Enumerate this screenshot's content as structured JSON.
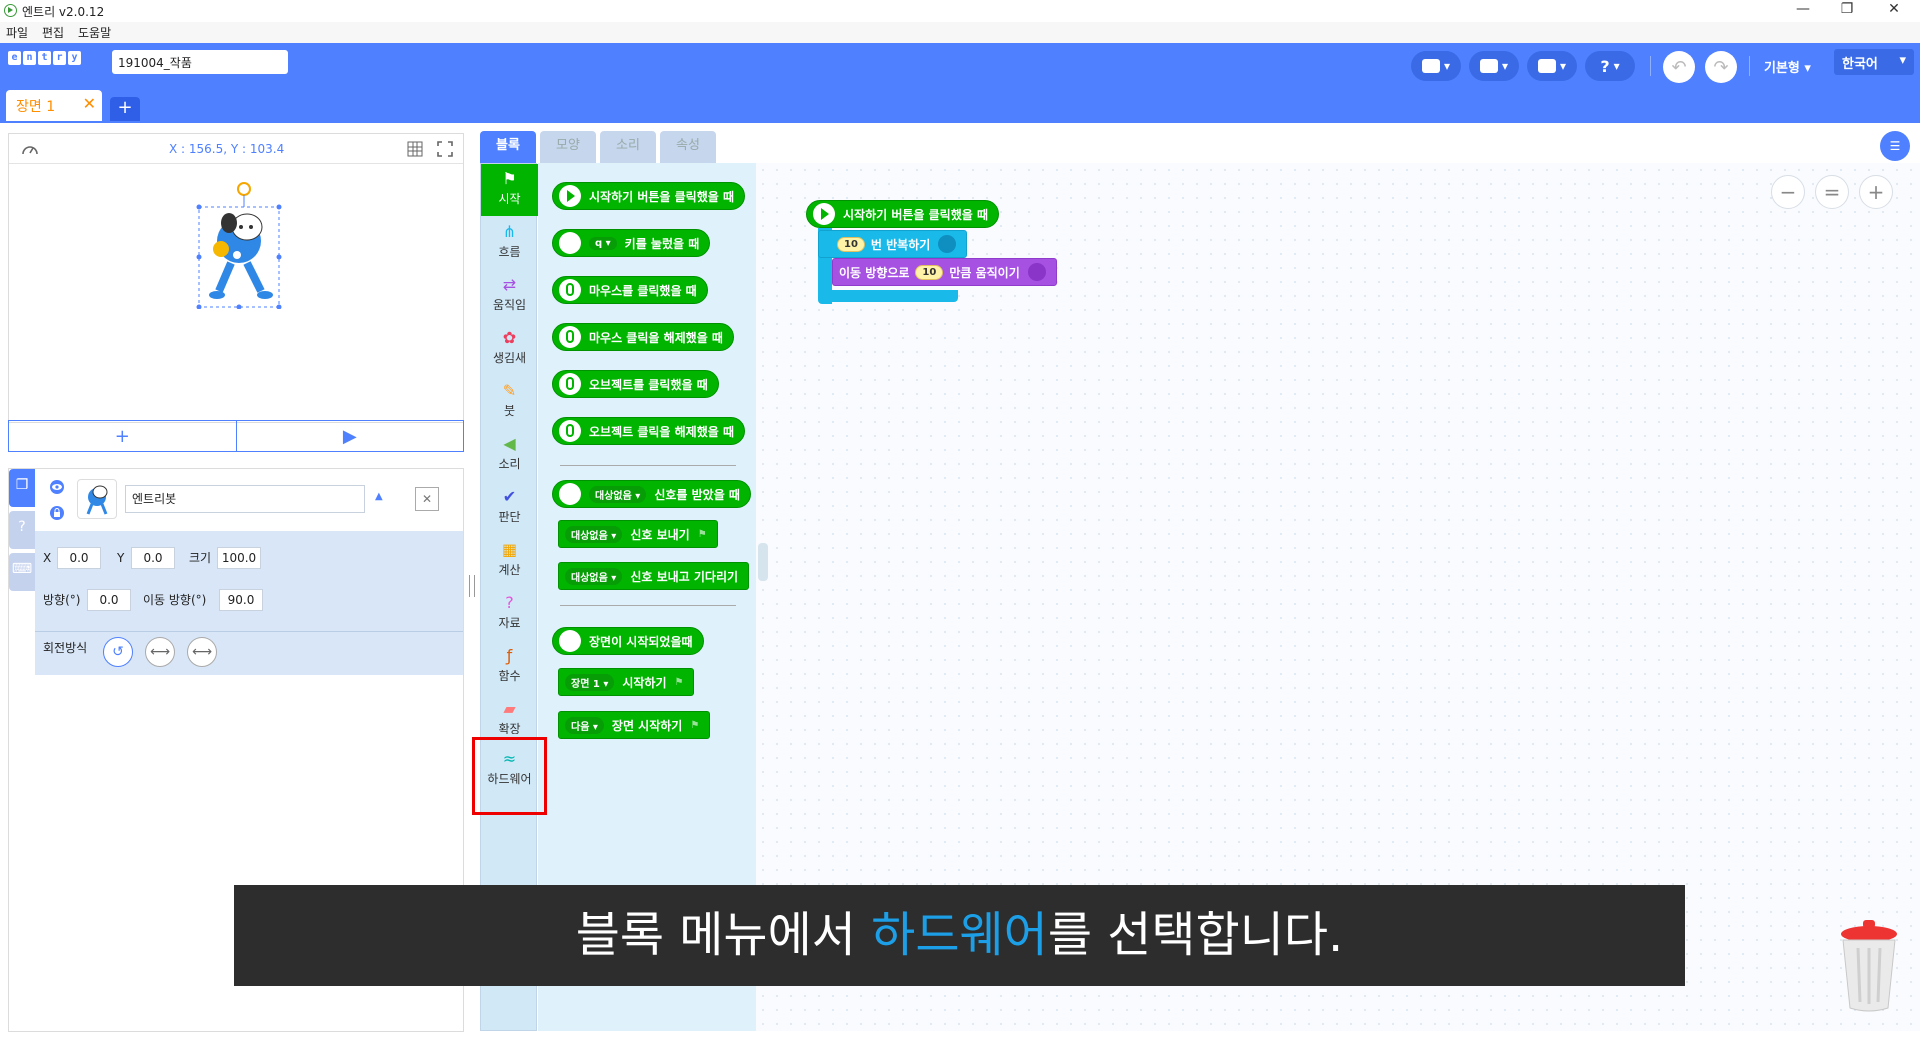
{
  "window": {
    "title": "엔트리 v2.0.12",
    "minimize": "—",
    "restore": "❐",
    "close": "✕"
  },
  "menu": [
    "파일",
    "편집",
    "도움말"
  ],
  "header": {
    "brand_letters": [
      "e",
      "n",
      "t",
      "r",
      "y"
    ],
    "project_name": "191004_작품",
    "buttons": [
      {
        "icon": "speech-bubble-icon",
        "caret": "▾"
      },
      {
        "icon": "document-icon",
        "caret": "▾"
      },
      {
        "icon": "save-icon",
        "caret": "▾"
      },
      {
        "icon": "help-icon",
        "label": "?",
        "caret": "▾"
      }
    ],
    "undo": "↶",
    "redo": "↷",
    "mode": "기본형 ▾",
    "language": "한국어",
    "language_caret": "▾"
  },
  "scene": {
    "tab_label": "장면 1",
    "close": "✕",
    "add": "+"
  },
  "stage": {
    "coords": "X : 156.5, Y : 103.4",
    "add_button": "+",
    "run_button": "▶"
  },
  "object": {
    "name": "엔트리봇",
    "x_label": "X",
    "x": "0.0",
    "y_label": "Y",
    "y": "0.0",
    "size_label": "크기",
    "size": "100.0",
    "direction_label": "방향(°)",
    "direction": "0.0",
    "move_dir_label": "이동 방향(°)",
    "move_dir": "90.0",
    "rotation_label": "회전방식",
    "close": "✕",
    "sort_caret": "▲"
  },
  "block_tabs": [
    "블록",
    "모양",
    "소리",
    "속성"
  ],
  "categories": [
    {
      "label": "시작",
      "icon": "⚑",
      "color": "#ffffff"
    },
    {
      "label": "흐름",
      "icon": "⋔",
      "color": "#19baea"
    },
    {
      "label": "움직임",
      "icon": "⇄",
      "color": "#a751e3"
    },
    {
      "label": "생김새",
      "icon": "✿",
      "color": "#ee3e5e"
    },
    {
      "label": "붓",
      "icon": "✎",
      "color": "#ff9e20"
    },
    {
      "label": "소리",
      "icon": "◀",
      "color": "#63b84a"
    },
    {
      "label": "판단",
      "icon": "✔",
      "color": "#4252e0"
    },
    {
      "label": "계산",
      "icon": "▦",
      "color": "#f3a600"
    },
    {
      "label": "자료",
      "icon": "?",
      "color": "#e457dc"
    },
    {
      "label": "함수",
      "icon": "ƒ",
      "color": "#de5c04"
    },
    {
      "label": "확장",
      "icon": "▰",
      "color": "#ff7a7a"
    },
    {
      "label": "하드웨어",
      "icon": "≈",
      "color": "#00b6b1"
    }
  ],
  "palette_blocks": [
    {
      "text": "시작하기 버튼을 클릭했을 때",
      "type": "play"
    },
    {
      "text": "키를 눌렀을 때",
      "dropdown": "q ▾",
      "type": "key"
    },
    {
      "text": "마우스를 클릭했을 때",
      "type": "mouse"
    },
    {
      "text": "마우스 클릭을 해제했을 때",
      "type": "mouse"
    },
    {
      "text": "오브젝트를 클릭했을 때",
      "type": "mouse"
    },
    {
      "text": "오브젝트 클릭을 해제했을 때",
      "type": "mouse"
    },
    {
      "text": "신호를 받았을 때",
      "dropdown": "대상없음 ▾",
      "type": "signal"
    },
    {
      "text": "신호 보내기",
      "dropdown": "대상없음 ▾",
      "type": "rect"
    },
    {
      "text": "신호 보내고 기다리기",
      "dropdown": "대상없음 ▾",
      "type": "rect"
    },
    {
      "text": "장면이 시작되었을때",
      "type": "scene"
    },
    {
      "text": "시작하기",
      "dropdown": "장면 1 ▾",
      "type": "rect"
    },
    {
      "text": "장면 시작하기",
      "dropdown": "다음 ▾",
      "type": "rect"
    }
  ],
  "script": {
    "hat": "시작하기 버튼을 클릭했을 때",
    "repeat_count": "10",
    "repeat_text": "번 반복하기",
    "move_prefix": "이동 방향으로",
    "move_amount": "10",
    "move_suffix": "만큼 움직이기"
  },
  "zoom": {
    "out": "−",
    "reset": "=",
    "in": "+"
  },
  "caption": {
    "before": "블록 메뉴에서 ",
    "highlight": "하드웨어",
    "after": "를 선택합니다."
  },
  "colors": {
    "header": "#4f80ff",
    "start_block": "#00b400",
    "highlight_box": "#ee0000",
    "caption_highlight": "#1c9fe6"
  }
}
